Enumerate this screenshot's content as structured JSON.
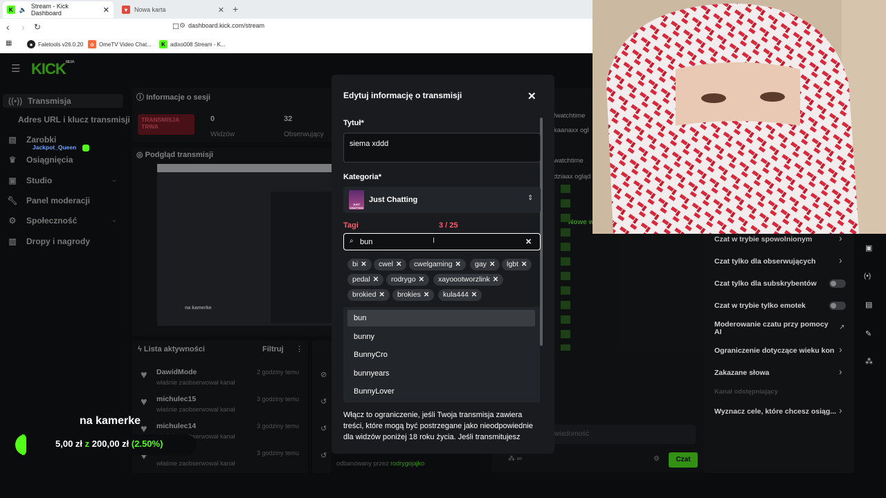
{
  "browser": {
    "tabs": [
      {
        "label": "Stream - Kick Dashboard",
        "active": true
      },
      {
        "label": "Nowa karta",
        "active": false
      }
    ],
    "url": "dashboard.kick.com/stream",
    "bookmarks": [
      "Faletools v26.0.20",
      "OmeTV Video Chat...",
      "adixo008 Stream - K..."
    ]
  },
  "app": {
    "logo": "KICK",
    "logo_badge": "BETA",
    "sidebar": [
      {
        "label": "Transmisja",
        "icon": "broadcast-icon"
      },
      {
        "label": "Adres URL i klucz transmisji",
        "icon": ""
      },
      {
        "label": "Zarobki",
        "icon": "earnings-icon"
      },
      {
        "label": "Osiągnięcia",
        "icon": "trophy-icon"
      },
      {
        "label": "Studio",
        "icon": "studio-icon"
      },
      {
        "label": "Panel moderacji",
        "icon": "wrench-icon"
      },
      {
        "label": "Społeczność",
        "icon": "community-icon"
      },
      {
        "label": "Dropy i nagrody",
        "icon": "gift-icon"
      }
    ],
    "username_overlay": "Jackpot_Queen",
    "session": {
      "header": "Informacje o sesji",
      "live_badge": "TRANSMISJA TRWA",
      "viewers_value": "0",
      "viewers_label": "Widzów",
      "followers_value": "32",
      "followers_label": "Obserwujący"
    },
    "preview": {
      "header": "Podgląd transmisji",
      "inner_caption": "na kamerke"
    },
    "activity": {
      "header": "Lista aktywności",
      "filter_label": "Filtruj",
      "items": [
        {
          "name": "DawidMode",
          "action": "właśnie zaobserwował kanał",
          "time": "2 godziny temu"
        },
        {
          "name": "michulec15",
          "action": "właśnie zaobserwował kanał",
          "time": "3 godziny temu"
        },
        {
          "name": "michulec14",
          "action": "właśnie zaobserwował kanał",
          "time": "3 godziny temu"
        },
        {
          "name": "",
          "action": "właśnie zaobserwował kanał",
          "time": "3 godziny temu"
        }
      ],
      "moderated_text": "odbanowany przez",
      "moderated_by": "rodrygojajko"
    },
    "chat": {
      "lines": [
        "!watchtime",
        "kaanaxx ogl",
        "watchtime",
        "dziaax ogląd"
      ],
      "new_label": "Nowe w",
      "input_placeholder": "wiadomość",
      "send_label": "Czat"
    },
    "chat_settings": [
      {
        "label": "Czat w trybie spowolnionym",
        "control": "chevron"
      },
      {
        "label": "Czat tylko dla obserwujących",
        "control": "chevron"
      },
      {
        "label": "Czat tylko dla subskrybentów",
        "control": "toggle"
      },
      {
        "label": "Czat w trybie tylko emotek",
        "control": "toggle"
      },
      {
        "label": "Moderowanie czatu przy pomocy AI",
        "control": "external"
      },
      {
        "label": "Ograniczenie dotyczące wieku kon",
        "control": "chevron"
      },
      {
        "label": "Zakazane słowa",
        "control": "chevron"
      },
      {
        "label": "Kanał odstępniający",
        "control": "none"
      },
      {
        "label": "Wyznacz cele, które chcesz osiąg...",
        "control": "chevron"
      }
    ]
  },
  "modal": {
    "title": "Edytuj informację o transmisji",
    "title_label": "Tytuł*",
    "title_value": "siema xddd",
    "category_label": "Kategoria*",
    "category_value": "Just Chatting",
    "category_thumb_text": "JUST CHATTING",
    "tags_label": "Tagi",
    "tags_count": "3 / 25",
    "tag_search_value": "bun",
    "tags": [
      "bi",
      "cwel",
      "cwelgaming",
      "gay",
      "lgbt",
      "pedal",
      "rodrygo",
      "xayoootworzlink",
      "brokied",
      "brokies",
      "kula444"
    ],
    "suggestions": [
      "bun",
      "bunny",
      "BunnyCro",
      "bunnyears",
      "BunnyLover"
    ],
    "description": "Włącz to ograniczenie, jeśli Twoja transmisja zawiera treści, które mogą być postrzegane jako nieodpowiednie dla widzów poniżej 18 roku życia. Jeśli transmitujesz"
  },
  "overlay": {
    "cam_label": "na kamerke",
    "goal_current": "5,00 zł",
    "goal_separator": "z",
    "goal_target": "200,00 zł",
    "goal_percent": "(2.50%)",
    "goal_fraction": 0.025
  },
  "colors": {
    "kick_green": "#53fc18",
    "live_red": "#e0253a",
    "tags_red": "#ff5a6a"
  }
}
